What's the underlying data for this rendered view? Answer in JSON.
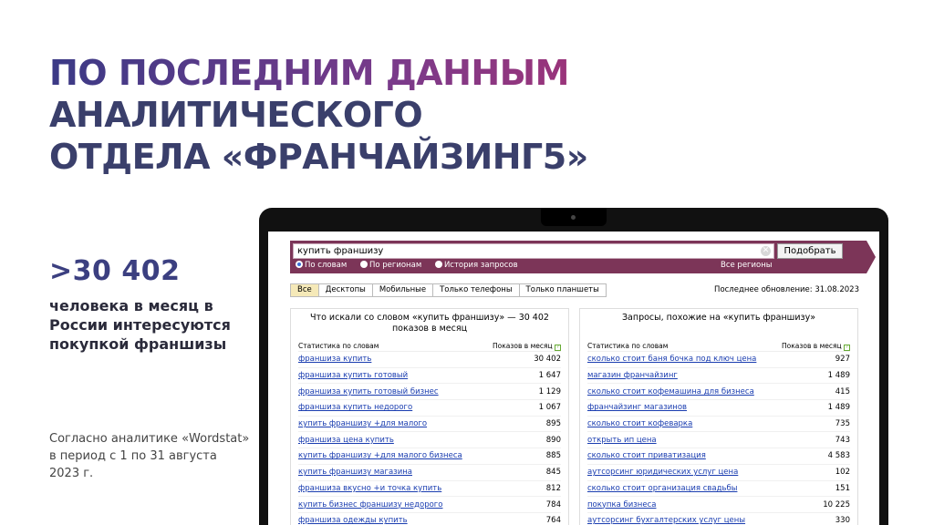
{
  "headline": {
    "line1": "ПО ПОСЛЕДНИМ ДАННЫМ",
    "line2": "АНАЛИТИЧЕСКОГО",
    "line3": "ОТДЕЛА «ФРАНЧАЙЗИНГ5»"
  },
  "stat": {
    "value": ">30 402",
    "description": "человека в месяц в России интересуются покупкой франшизы"
  },
  "source_note": "Согласно аналитике «Wordstat» в период с 1 по 31 августа 2023 г.",
  "colors": {
    "accent_purple": "#3b3f80",
    "search_bar": "#7c3558",
    "link": "#1a3db0"
  },
  "wordstat": {
    "search": {
      "query": "купить франшизу",
      "button": "Подобрать"
    },
    "radios": [
      {
        "label": "По словам",
        "selected": true
      },
      {
        "label": "По регионам",
        "selected": false
      },
      {
        "label": "История запросов",
        "selected": false
      }
    ],
    "regions": "Все регионы",
    "tabs": [
      "Все",
      "Десктопы",
      "Мобильные",
      "Только телефоны",
      "Только планшеты"
    ],
    "active_tab": "Все",
    "last_update": "Последнее обновление: 31.08.2023",
    "left": {
      "title": "Что искали со словом «купить франшизу» — 30 402 показов в месяц",
      "col1": "Статистика по словам",
      "col2": "Показов в месяц",
      "rows": [
        {
          "q": "франшиза купить",
          "n": "30 402"
        },
        {
          "q": "франшиза купить готовый",
          "n": "1 647"
        },
        {
          "q": "франшиза купить готовый бизнес",
          "n": "1 129"
        },
        {
          "q": "франшиза купить недорого",
          "n": "1 067"
        },
        {
          "q": "купить франшизу +для малого",
          "n": "895"
        },
        {
          "q": "франшиза цена купить",
          "n": "890"
        },
        {
          "q": "купить франшизу +для малого бизнеса",
          "n": "885"
        },
        {
          "q": "купить франшизу магазина",
          "n": "845"
        },
        {
          "q": "франшиза вкусно +и точка купить",
          "n": "812"
        },
        {
          "q": "купить бизнес франшизу недорого",
          "n": "784"
        },
        {
          "q": "франшиза одежды купить",
          "n": "764"
        }
      ]
    },
    "right": {
      "title": "Запросы, похожие на «купить франшизу»",
      "col1": "Статистика по словам",
      "col2": "Показов в месяц",
      "rows": [
        {
          "q": "сколько стоит баня бочка под ключ цена",
          "n": "927"
        },
        {
          "q": "магазин франчайзинг",
          "n": "1 489"
        },
        {
          "q": "сколько стоит кофемашина для бизнеса",
          "n": "415"
        },
        {
          "q": "франчайзинг магазинов",
          "n": "1 489"
        },
        {
          "q": "сколько стоит кофеварка",
          "n": "735"
        },
        {
          "q": "открыть ип цена",
          "n": "743"
        },
        {
          "q": "сколько стоит приватизация",
          "n": "4 583"
        },
        {
          "q": "аутсорсинг юридических услуг цена",
          "n": "102"
        },
        {
          "q": "сколько стоит организация свадьбы",
          "n": "151"
        },
        {
          "q": "покупка бизнеса",
          "n": "10 225"
        },
        {
          "q": "аутсорсинг бухгалтерских услуг цены",
          "n": "330"
        }
      ]
    }
  }
}
